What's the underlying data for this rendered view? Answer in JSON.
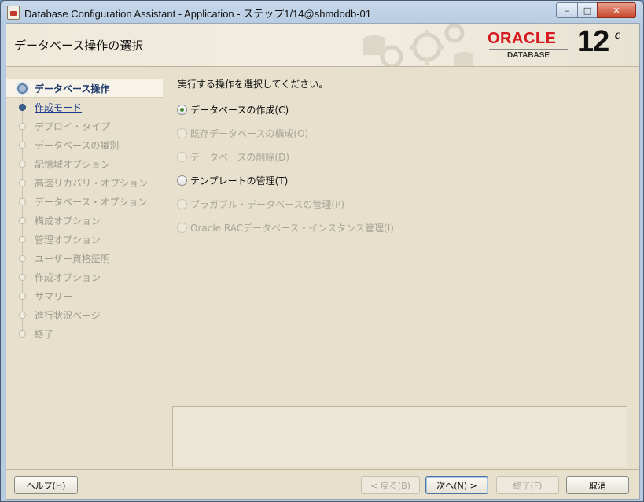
{
  "window": {
    "title": "Database Configuration Assistant - Application - ステップ1/14@shmdodb-01",
    "min_glyph": "–",
    "max_glyph": "□",
    "close_glyph": "✕"
  },
  "header": {
    "title": "データベース操作の選択",
    "logo_text": "ORACLE",
    "logo_sub": "DATABASE",
    "version": "12",
    "version_suffix": "c"
  },
  "nav": {
    "items": [
      {
        "label": "データベース操作",
        "state": "active"
      },
      {
        "label": "作成モード",
        "state": "link"
      },
      {
        "label": "デプロイ・タイプ",
        "state": "disabled"
      },
      {
        "label": "データベースの識別",
        "state": "disabled"
      },
      {
        "label": "記憶域オプション",
        "state": "disabled"
      },
      {
        "label": "高速リカバリ・オプション",
        "state": "disabled"
      },
      {
        "label": "データベース・オプション",
        "state": "disabled"
      },
      {
        "label": "構成オプション",
        "state": "disabled"
      },
      {
        "label": "管理オプション",
        "state": "disabled"
      },
      {
        "label": "ユーザー資格証明",
        "state": "disabled"
      },
      {
        "label": "作成オプション",
        "state": "disabled"
      },
      {
        "label": "サマリー",
        "state": "disabled"
      },
      {
        "label": "進行状況ページ",
        "state": "disabled"
      },
      {
        "label": "終了",
        "state": "disabled"
      }
    ]
  },
  "main": {
    "instruction": "実行する操作を選択してください。",
    "options": [
      {
        "label": "データベースの作成(C)",
        "checked": true,
        "enabled": true
      },
      {
        "label": "既存データベースの構成(O)",
        "checked": false,
        "enabled": false
      },
      {
        "label": "データベースの削除(D)",
        "checked": false,
        "enabled": false
      },
      {
        "label": "テンプレートの管理(T)",
        "checked": false,
        "enabled": true
      },
      {
        "label": "プラガブル・データベースの管理(P)",
        "checked": false,
        "enabled": false
      },
      {
        "label": "Oracle RACデータベース・インスタンス管理(I)",
        "checked": false,
        "enabled": false
      }
    ]
  },
  "footer": {
    "help": "ヘルプ(H)",
    "back": "< 戻る(B)",
    "next": "次へ(N) >",
    "finish": "終了(F)",
    "cancel": "取消"
  }
}
